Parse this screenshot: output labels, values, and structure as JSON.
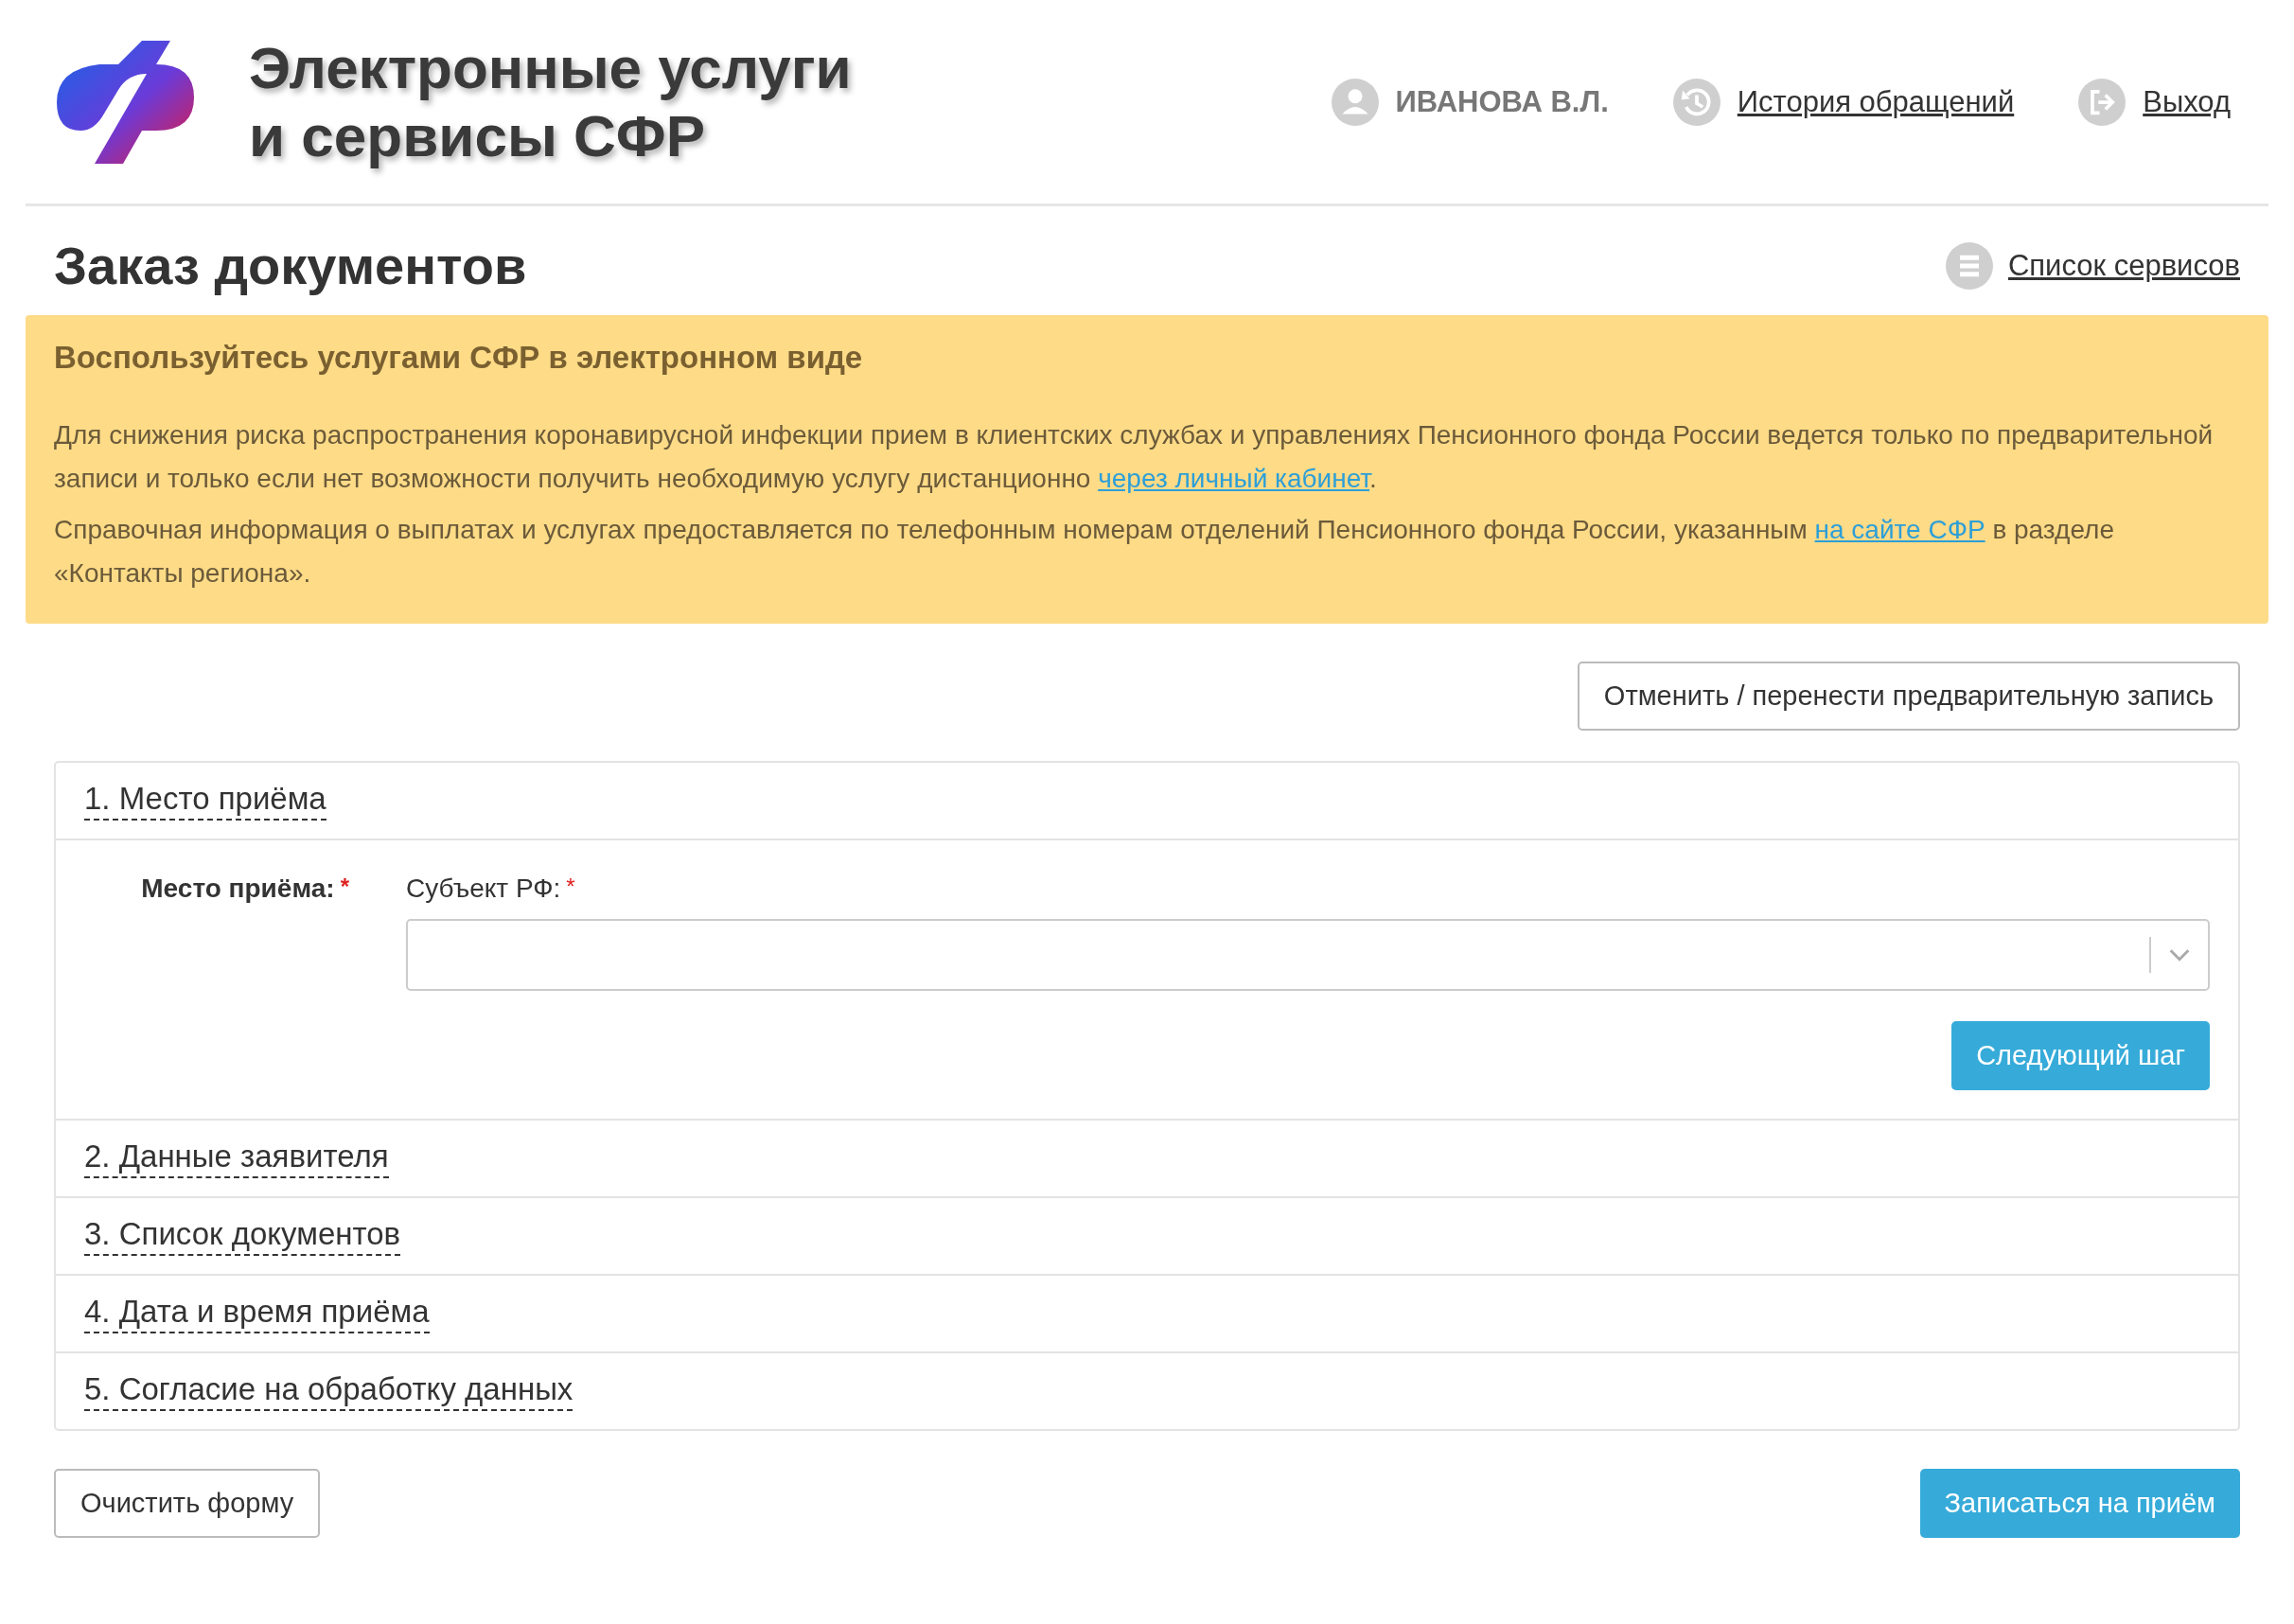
{
  "header": {
    "title_lines": [
      "Электронные услуги",
      "и сервисы СФР"
    ],
    "user": "ИВАНОВА В.Л.",
    "links": [
      {
        "kind": "history",
        "label": "История обращений"
      },
      {
        "kind": "exit",
        "label": "Выход"
      }
    ]
  },
  "page_title": "Заказ документов",
  "services_link": "Список сервисов",
  "notice": {
    "title": "Воспользуйтесь услугами СФР в электронном виде",
    "paragraphs": [
      [
        {
          "kind": "text",
          "text": "Для снижения риска распространения коронавирусной инфекции прием в клиентских службах и управлениях Пенсионного фонда России ведется только по предварительной записи и только если нет возможности получить необходимую услугу дистанционно "
        },
        {
          "kind": "link",
          "text": "через личный кабинет"
        },
        {
          "kind": "text",
          "text": "."
        }
      ],
      [
        {
          "kind": "text",
          "text": "Справочная информация о выплатах и услугах предоставляется по телефонным номерам отделений Пенсионного фонда России, указанным "
        },
        {
          "kind": "link",
          "text": "на сайте СФР"
        },
        {
          "kind": "text",
          "text": " в разделе «Контакты региона»."
        }
      ]
    ]
  },
  "cancel_button": "Отменить / перенести предварительную запись",
  "steps": [
    {
      "label": "1. Место приёма",
      "form": {
        "group_label": "Место приёма:",
        "group_required": "*",
        "field_label": "Субъект РФ:",
        "field_required": "*",
        "next_button": "Следующий шаг"
      }
    },
    {
      "label": "2. Данные заявителя"
    },
    {
      "label": "3. Список документов"
    },
    {
      "label": "4. Дата и время приёма"
    },
    {
      "label": "5. Согласие на обработку данных"
    }
  ],
  "clear_button": "Очистить форму",
  "submit_button": "Записаться на приём"
}
